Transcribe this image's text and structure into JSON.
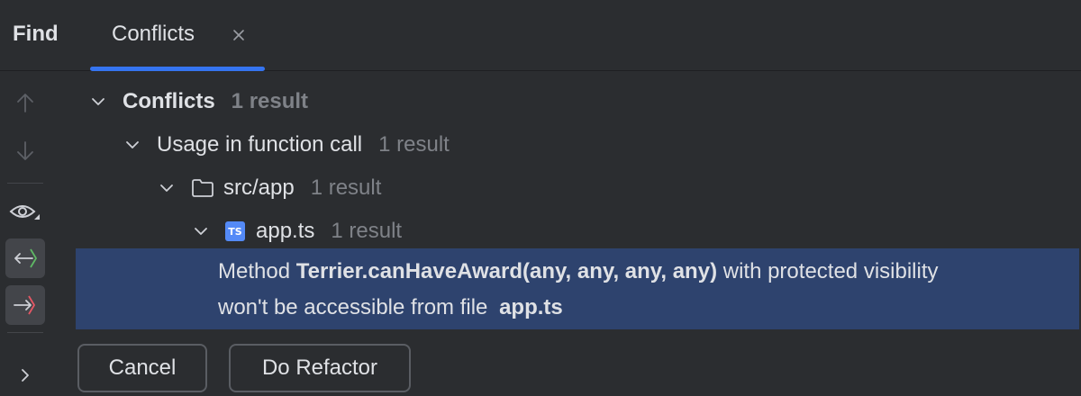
{
  "header": {
    "find_label": "Find",
    "tab_label": "Conflicts"
  },
  "tree": {
    "root": {
      "label": "Conflicts",
      "count": "1 result"
    },
    "usage": {
      "label": "Usage in function call",
      "count": "1 result"
    },
    "folder": {
      "label": "src/app",
      "count": "1 result"
    },
    "file": {
      "label": "app.ts",
      "count": "1 result",
      "badge": "TS"
    },
    "message": {
      "prefix": "Method",
      "method": "Terrier.canHaveAward(any, any, any, any)",
      "suffix": "with protected visibility",
      "line2": "won't be accessible from file",
      "file": "app.ts"
    }
  },
  "buttons": {
    "cancel": "Cancel",
    "do_refactor": "Do Refactor"
  },
  "colors": {
    "background": "#2b2d30",
    "accent": "#3574f0",
    "selection": "#2e436e",
    "ts_badge": "#548af7",
    "muted_text": "#7f8288"
  }
}
